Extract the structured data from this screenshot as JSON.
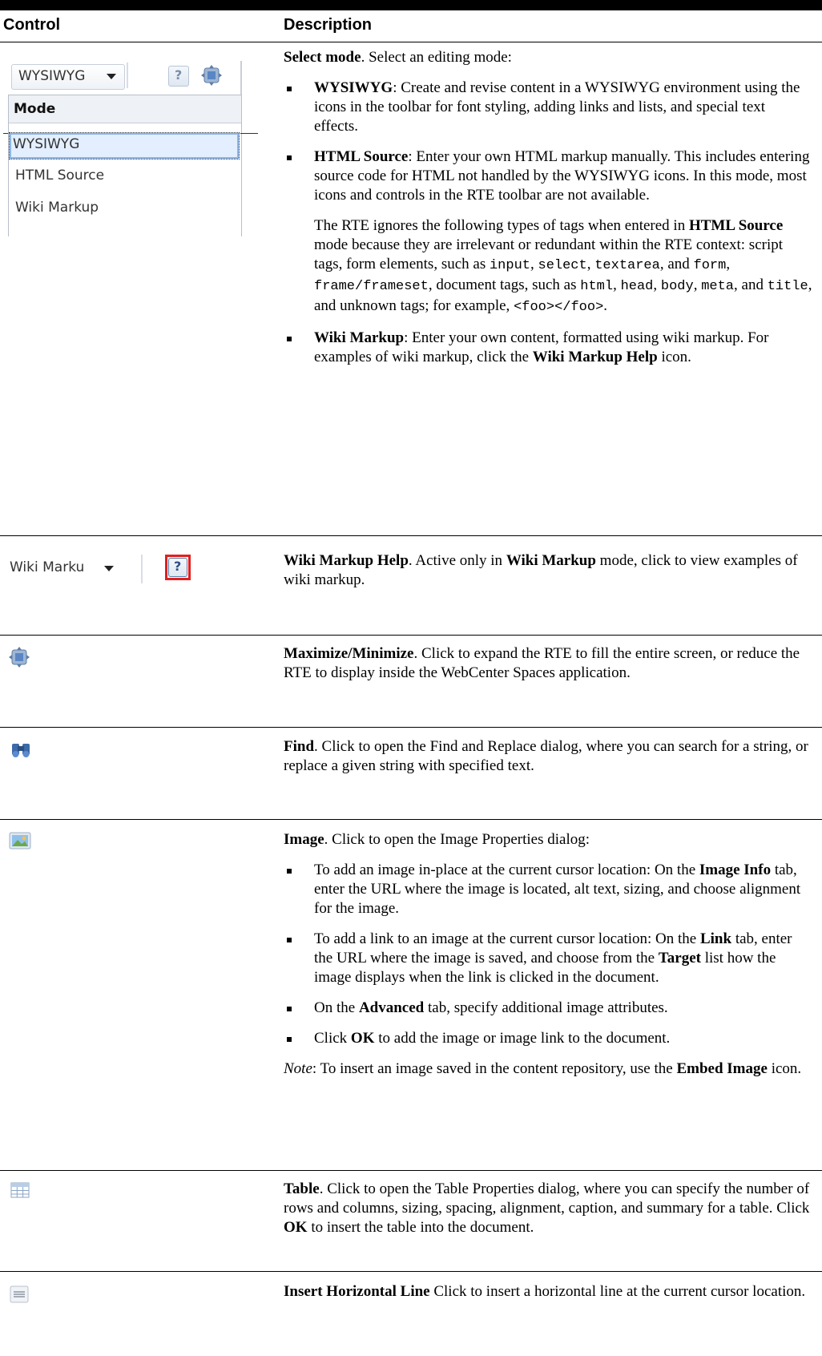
{
  "header": {
    "top_caption": "",
    "col_control": "Control",
    "col_description": "Description"
  },
  "rows": {
    "mode": {
      "control": {
        "select_value": "WYSIWYG",
        "menu_title": "Mode",
        "options": [
          "WYSIWYG",
          "HTML Source",
          "Wiki Markup"
        ]
      },
      "title": "Select mode",
      "intro": ". Select an editing mode:",
      "b1_term": "WYSIWYG",
      "b1_text": ": Create and revise content in a WYSIWYG environment using the icons in the toolbar for font styling, adding links and lists, and special text effects.",
      "b2_term": "HTML Source",
      "b2_text": ": Enter your own HTML markup manually. This includes entering source code for HTML not handled by the WYSIWYG icons. In this mode, most icons and controls in the RTE toolbar are not available.",
      "p_a": "The RTE ignores the following types of tags when entered in ",
      "p_b": "HTML Source",
      "p_c": " mode because they are irrelevant or redundant within the RTE context: script tags, form elements, such as ",
      "c_input": "input",
      "c_select": "select",
      "c_textarea": "textarea",
      "p_d": ", and ",
      "c_form": "form",
      "p_e": ", ",
      "c_frame": "frame/frameset",
      "p_f": ", document tags, such as ",
      "c_html": "html",
      "c_head": "head",
      "c_body": "body",
      "c_meta": "meta",
      "p_g": ", and ",
      "c_title": "title",
      "p_h": ", and unknown tags; for example, ",
      "c_foo": "<foo></foo>",
      "p_i": ".",
      "b3_term": "Wiki Markup",
      "b3_text": ": Enter your own content, formatted using wiki markup. For examples of wiki markup, click the ",
      "b3_link": "Wiki Markup Help",
      "b3_end": " icon."
    },
    "wiki": {
      "control": {
        "select_value": "Wiki Marku"
      },
      "title": "Wiki Markup Help",
      "t1": ". Active only in ",
      "t2": "Wiki Markup",
      "t3": " mode, click to view examples of wiki markup."
    },
    "maximize": {
      "title": "Maximize/Minimize",
      "text": ".  Click to expand the RTE to fill the entire screen, or reduce the RTE to display inside the WebCenter Spaces application."
    },
    "find": {
      "title": "Find",
      "text": ". Click to open the Find and Replace dialog, where you can search for a string, or replace a given string with specified text."
    },
    "image": {
      "title": "Image",
      "intro": ". Click to open the Image Properties dialog:",
      "b1_a": "To add an image in-place at the current cursor location: On the ",
      "b1_b": "Image Info",
      "b1_c": " tab, enter the URL where the image is located, alt text, sizing, and choose alignment for the image.",
      "b2_a": "To add a link to an image at the current cursor location: On the ",
      "b2_b": "Link",
      "b2_c": " tab, enter the URL where the image is saved, and choose from the ",
      "b2_d": "Target",
      "b2_e": " list how the image displays when the link is clicked in the document.",
      "b3_a": "On the ",
      "b3_b": "Advanced",
      "b3_c": " tab, specify additional image attributes.",
      "b4_a": "Click ",
      "b4_b": "OK",
      "b4_c": " to add the image or image link to the document.",
      "note_label": "Note",
      "note_a": ": To insert an image saved in the content repository, use the ",
      "note_b": "Embed Image",
      "note_c": " icon."
    },
    "table": {
      "title": "Table",
      "t1": ". Click to open the Table Properties dialog, where you can specify the number of rows and columns, sizing, spacing, alignment, caption, and summary for a table.  Click ",
      "t2": "OK",
      "t3": " to insert the table into the document."
    },
    "hline": {
      "title": "Insert Horizontal Line",
      "text": "  Click to insert a horizontal line at the current cursor location."
    }
  }
}
